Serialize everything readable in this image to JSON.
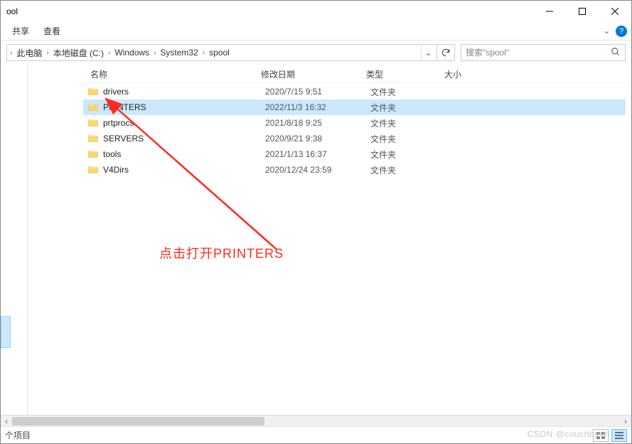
{
  "titlebar": {
    "title": "ool"
  },
  "ribbon": {
    "tabs": [
      "共享",
      "查看"
    ]
  },
  "breadcrumb": {
    "segments": [
      "此电脑",
      "本地磁盘 (C:)",
      "Windows",
      "System32",
      "spool"
    ]
  },
  "search": {
    "placeholder": "搜索\"spool\""
  },
  "columns": {
    "name": "名称",
    "date": "修改日期",
    "type": "类型",
    "size": "大小"
  },
  "rows": [
    {
      "name": "drivers",
      "date": "2020/7/15 9:51",
      "type": "文件夹",
      "size": "",
      "selected": false
    },
    {
      "name": "PRINTERS",
      "date": "2022/11/3 16:32",
      "type": "文件夹",
      "size": "",
      "selected": true
    },
    {
      "name": "prtprocs",
      "date": "2021/8/18 9:25",
      "type": "文件夹",
      "size": "",
      "selected": false
    },
    {
      "name": "SERVERS",
      "date": "2020/9/21 9:38",
      "type": "文件夹",
      "size": "",
      "selected": false
    },
    {
      "name": "tools",
      "date": "2021/1/13 16:37",
      "type": "文件夹",
      "size": "",
      "selected": false
    },
    {
      "name": "V4Dirs",
      "date": "2020/12/24 23:59",
      "type": "文件夹",
      "size": "",
      "selected": false
    }
  ],
  "annotation": {
    "text": "点击打开PRINTERS"
  },
  "statusbar": {
    "text": "个项目"
  },
  "watermark": "CSDN @couchbrain"
}
